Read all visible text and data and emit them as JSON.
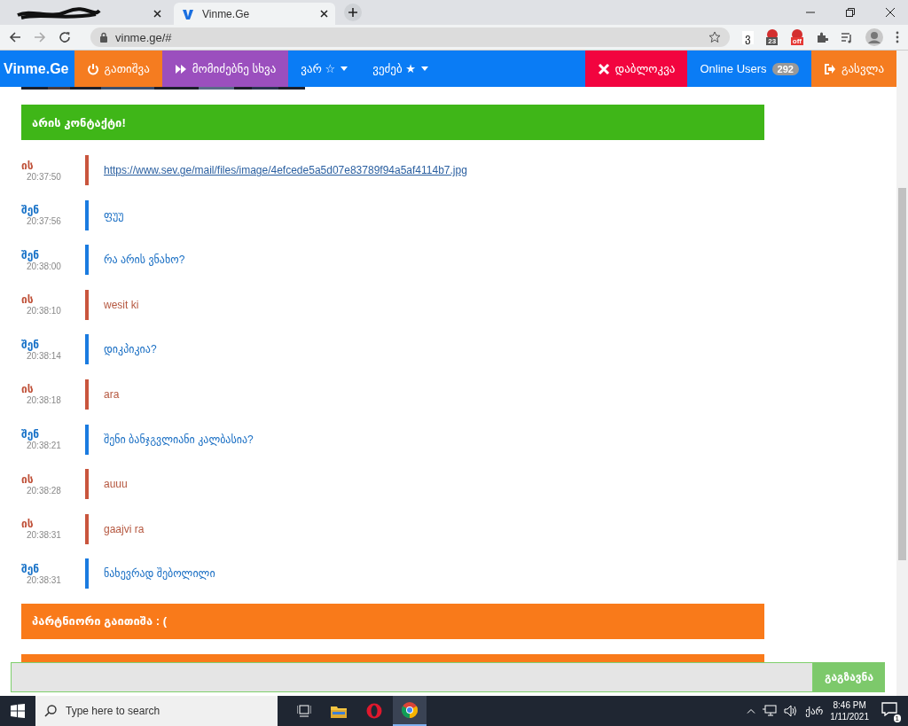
{
  "browser": {
    "tabs": [
      {
        "selected": false,
        "redacted": true
      },
      {
        "title": "Vinme.Ge",
        "selected": true,
        "redacted": false
      }
    ],
    "address": "vinme.ge/#",
    "extensions": [
      {
        "kind": "letter",
        "text": "ვ"
      },
      {
        "kind": "badge",
        "text": "23"
      },
      {
        "kind": "badge",
        "text": "off"
      }
    ]
  },
  "nav": {
    "logo": "Vinme.Ge",
    "items": [
      {
        "label": "გათიშვა",
        "color": "#f57c20",
        "caret": false
      },
      {
        "label": "მომიძებნე სხვა",
        "color": "#9b4fbe",
        "caret": false
      },
      {
        "label": "ვარ ☆",
        "color": "#0a7cf5",
        "caret": true
      },
      {
        "label": "ვეძებ ★",
        "color": "#0a7cf5",
        "caret": true
      },
      {
        "label": "დაბლოკვა",
        "color": "#f2043f",
        "caret": false
      },
      {
        "label": "Online Users",
        "color": "#0a7cf5",
        "caret": false,
        "badge": "292"
      },
      {
        "label": "გასვლა",
        "color": "#f57c20",
        "caret": false
      }
    ]
  },
  "notices_top": [
    {
      "kind": "success",
      "text": "არის კონტაქტი!"
    }
  ],
  "messages": [
    {
      "sender": "ის",
      "kind": "them",
      "time": "20:37:50",
      "text": "https://www.sev.ge/mail/files/image/4efcede5a5d07e83789f94a5af4114b7.jpg",
      "link": true
    },
    {
      "sender": "შენ",
      "kind": "me",
      "time": "20:37:56",
      "text": "ფუუ",
      "link": false
    },
    {
      "sender": "შენ",
      "kind": "me",
      "time": "20:38:00",
      "text": "რა არის ვნახო?",
      "link": false
    },
    {
      "sender": "ის",
      "kind": "them",
      "time": "20:38:10",
      "text": "wesit ki",
      "link": false
    },
    {
      "sender": "შენ",
      "kind": "me",
      "time": "20:38:14",
      "text": "დიკპიკია?",
      "link": false
    },
    {
      "sender": "ის",
      "kind": "them",
      "time": "20:38:18",
      "text": "ara",
      "link": false
    },
    {
      "sender": "შენ",
      "kind": "me",
      "time": "20:38:21",
      "text": "შენი ბანჯგვლიანი კალბასია?",
      "link": false
    },
    {
      "sender": "ის",
      "kind": "them",
      "time": "20:38:28",
      "text": "auuu",
      "link": false
    },
    {
      "sender": "ის",
      "kind": "them",
      "time": "20:38:31",
      "text": "gaajvi ra",
      "link": false
    },
    {
      "sender": "შენ",
      "kind": "me",
      "time": "20:38:31",
      "text": "ნახევრად შებოლილი",
      "link": false
    }
  ],
  "notices_bottom": [
    {
      "kind": "warning",
      "text": "პარტნიორი გაითიშა : ("
    },
    {
      "kind": "warning"
    }
  ],
  "composer": {
    "send_label": "გაგზავნა"
  },
  "taskbar": {
    "search_placeholder": "Type here to search",
    "language": "ქარ",
    "time": "8:46 PM",
    "date": "1/11/2021",
    "notifications": "1"
  }
}
